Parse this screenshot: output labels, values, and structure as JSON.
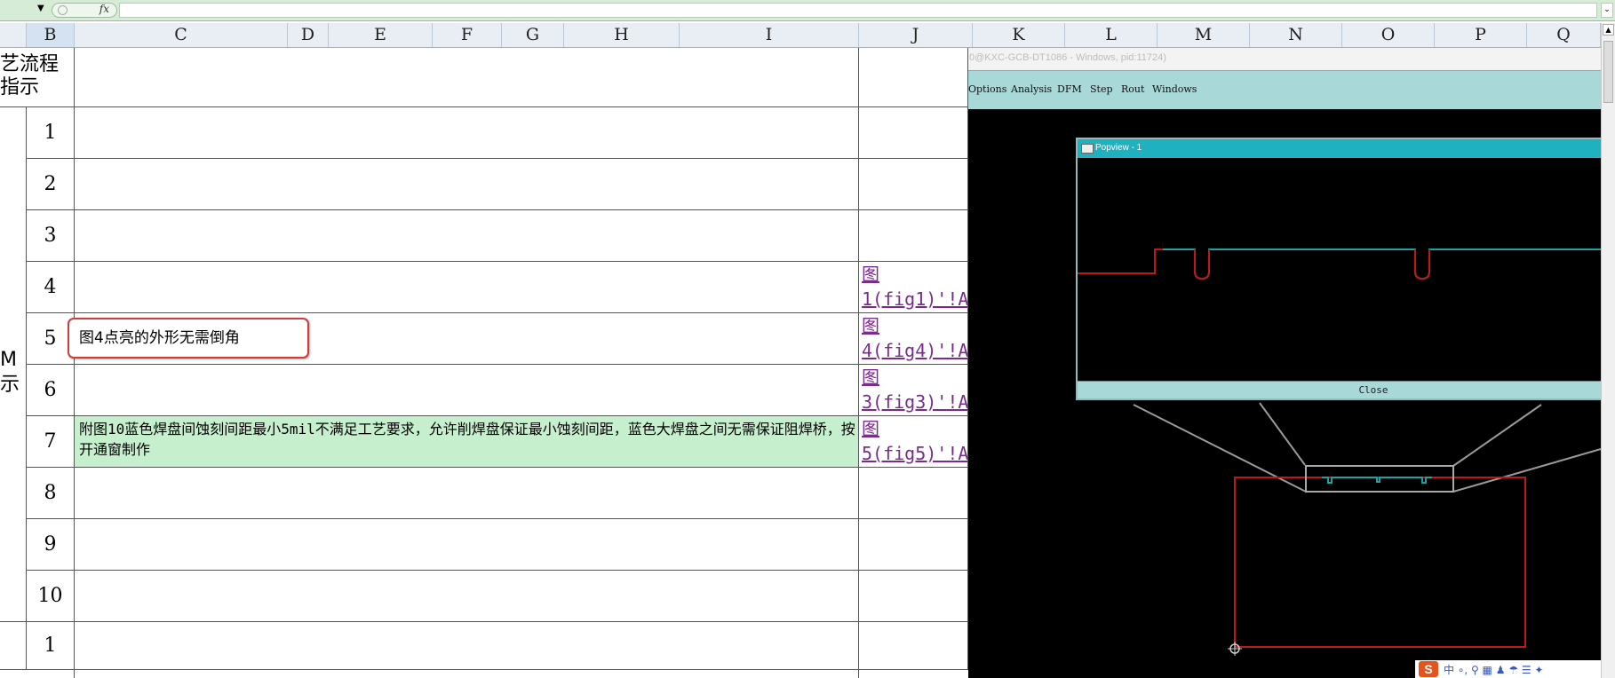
{
  "formula_bar": {
    "fx": "fx"
  },
  "columns": [
    "B",
    "C",
    "D",
    "E",
    "F",
    "G",
    "H",
    "I",
    "J",
    "K",
    "L",
    "M",
    "N",
    "O",
    "P",
    "Q"
  ],
  "section_header": {
    "label_line1": "艺流程",
    "label_line2": "指示"
  },
  "left_fragment": {
    "line1": "M",
    "line2": "示"
  },
  "rows": [
    {
      "num": "1"
    },
    {
      "num": "2"
    },
    {
      "num": "3"
    },
    {
      "num": "4",
      "link_line1": "图",
      "link_line2": "1(fig1)'!A"
    },
    {
      "num": "5",
      "link_line1": "图",
      "link_line2": "4(fig4)'!A"
    },
    {
      "num": "6",
      "link_line1": "图",
      "link_line2": "3(fig3)'!A"
    },
    {
      "num": "7",
      "link_line1": "图",
      "link_line2": "5(fig5)'!A"
    },
    {
      "num": "8"
    },
    {
      "num": "9"
    },
    {
      "num": "10"
    },
    {
      "num": "1"
    }
  ],
  "callout_text": "图4点亮的外形无需倒角",
  "row7_note": "附图10蓝色焊盘间蚀刻间距最小5mil不满足工艺要求，允许削焊盘保证最小蚀刻间距，蓝色大焊盘之间无需保证阻焊桥，按开通窗制作",
  "cam": {
    "title": "0@KXC-GCB-DT1086 - Windows, pid:11724)",
    "menu": [
      "Options",
      "Analysis",
      "DFM",
      "Step",
      "Rout",
      "Windows"
    ],
    "popview_title": "Popview - 1",
    "popview_close": "Close"
  },
  "taskbar": {
    "ime": "S",
    "glyphs": "中 ∘, ⚲ ▦ ♟ ☂ ☰ ✦"
  },
  "colors": {
    "note_fill": "#c6efce",
    "link": "#7b2a8f",
    "trace_red": "#c01717",
    "trace_teal": "#1aa3a3",
    "callout_border": "#d23b3b"
  }
}
